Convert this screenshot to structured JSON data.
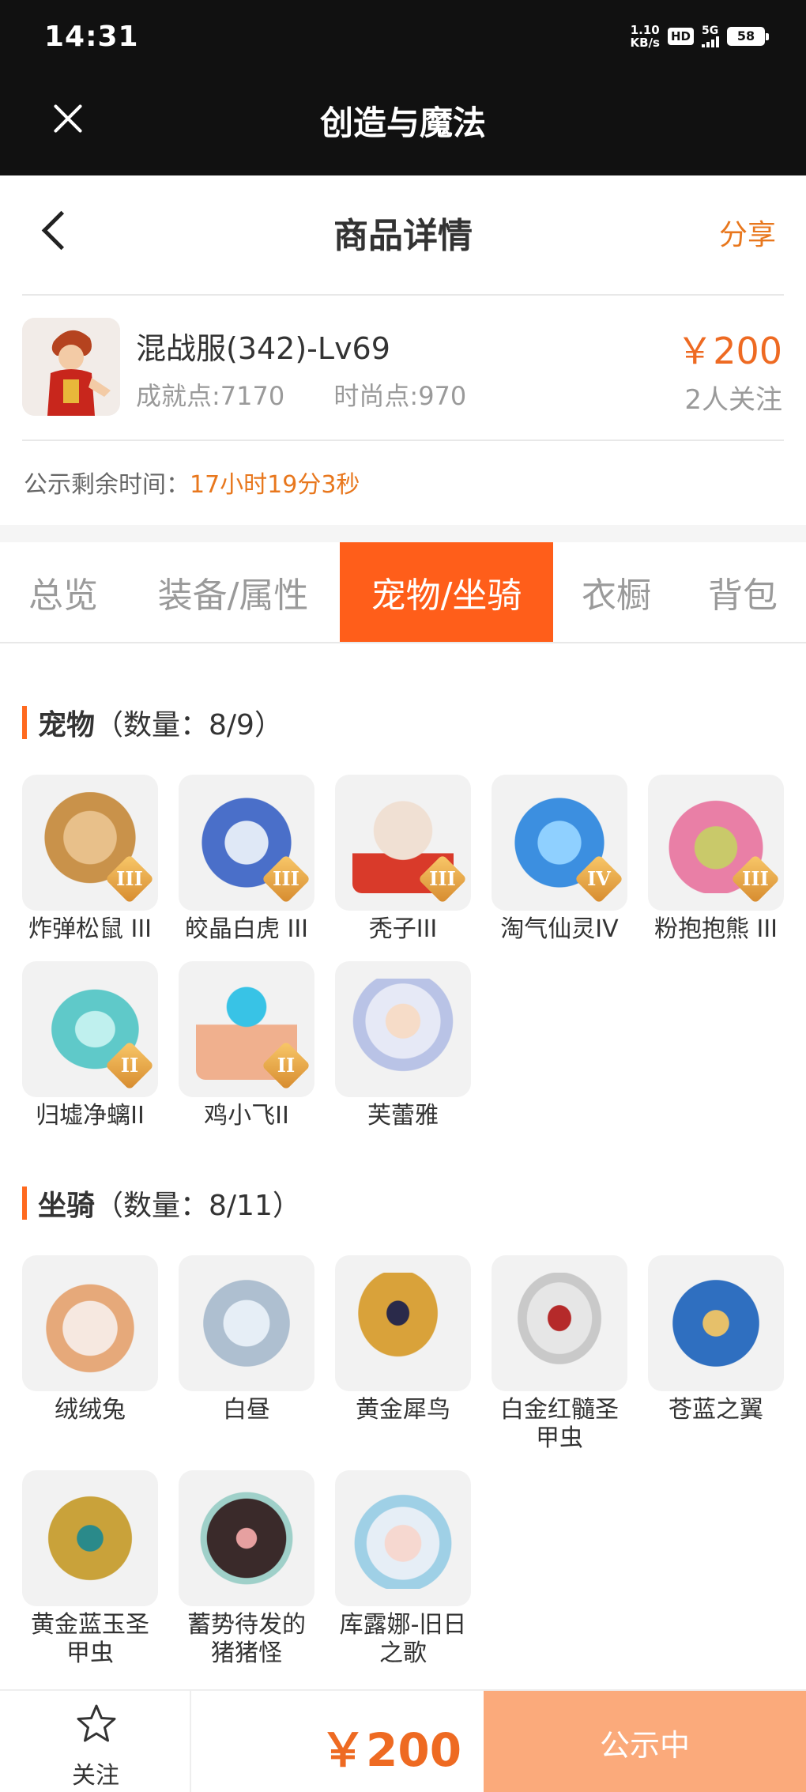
{
  "status_bar": {
    "time": "14:31",
    "net_speed_value": "1.10",
    "net_speed_unit": "KB/s",
    "hd": "HD",
    "network": "5G",
    "battery": "58"
  },
  "app_bar": {
    "title": "创造与魔法",
    "close_icon": "close-icon"
  },
  "page_nav": {
    "title": "商品详情",
    "share_label": "分享",
    "back_icon": "chevron-left-icon"
  },
  "product": {
    "name": "混战服(342)-Lv69",
    "achievement": "成就点:7170",
    "fashion": "时尚点:970",
    "price": "￥200",
    "followers": "2人关注",
    "remaining_label": "公示剩余时间：",
    "remaining_value": "17小时19分3秒"
  },
  "tabs": [
    {
      "label": "总览",
      "active": false
    },
    {
      "label": "装备/属性",
      "active": false
    },
    {
      "label": "宠物/坐骑",
      "active": true
    },
    {
      "label": "衣橱",
      "active": false
    },
    {
      "label": "背包",
      "active": false
    }
  ],
  "pets": {
    "title": "宠物",
    "count": "（数量：8/9）",
    "items": [
      {
        "name": "炸弹松鼠 III",
        "badge": "III",
        "color": "#c9924a"
      },
      {
        "name": "皎晶白虎 III",
        "badge": "III",
        "color": "#4a6fc9"
      },
      {
        "name": "秃子III",
        "badge": "III",
        "color": "#e9d3c2"
      },
      {
        "name": "淘气仙灵IV",
        "badge": "IV",
        "color": "#3c8fe0"
      },
      {
        "name": "粉抱抱熊 III",
        "badge": "III",
        "color": "#e97fa6"
      },
      {
        "name": "归墟净螭II",
        "badge": "II",
        "color": "#5fc9c9"
      },
      {
        "name": "鸡小飞II",
        "badge": "II",
        "color": "#f0b08e"
      },
      {
        "name": "芙蕾雅",
        "badge": "",
        "color": "#b9c3e6"
      }
    ]
  },
  "mounts": {
    "title": "坐骑",
    "count": "（数量：8/11）",
    "items": [
      {
        "name": "绒绒兔",
        "color": "#e6a97a"
      },
      {
        "name": "白昼",
        "color": "#aebfd0"
      },
      {
        "name": "黄金犀鸟",
        "color": "#d9a23a"
      },
      {
        "name": "白金红髓圣甲虫",
        "color": "#c9c9c9"
      },
      {
        "name": "苍蓝之翼",
        "color": "#2f6fc0"
      },
      {
        "name": "黄金蓝玉圣甲虫",
        "color": "#c9a23a"
      },
      {
        "name": "蓄势待发的猪猪怪",
        "color": "#3a2a2a"
      },
      {
        "name": "库露娜-旧日之歌",
        "color": "#9fd0e6"
      }
    ]
  },
  "bottom_bar": {
    "follow_label": "关注",
    "price": "￥200",
    "status_label": "公示中"
  },
  "colors": {
    "accent": "#ff5e1a",
    "price": "#ee6a22",
    "status_button": "#fbaa7b"
  }
}
